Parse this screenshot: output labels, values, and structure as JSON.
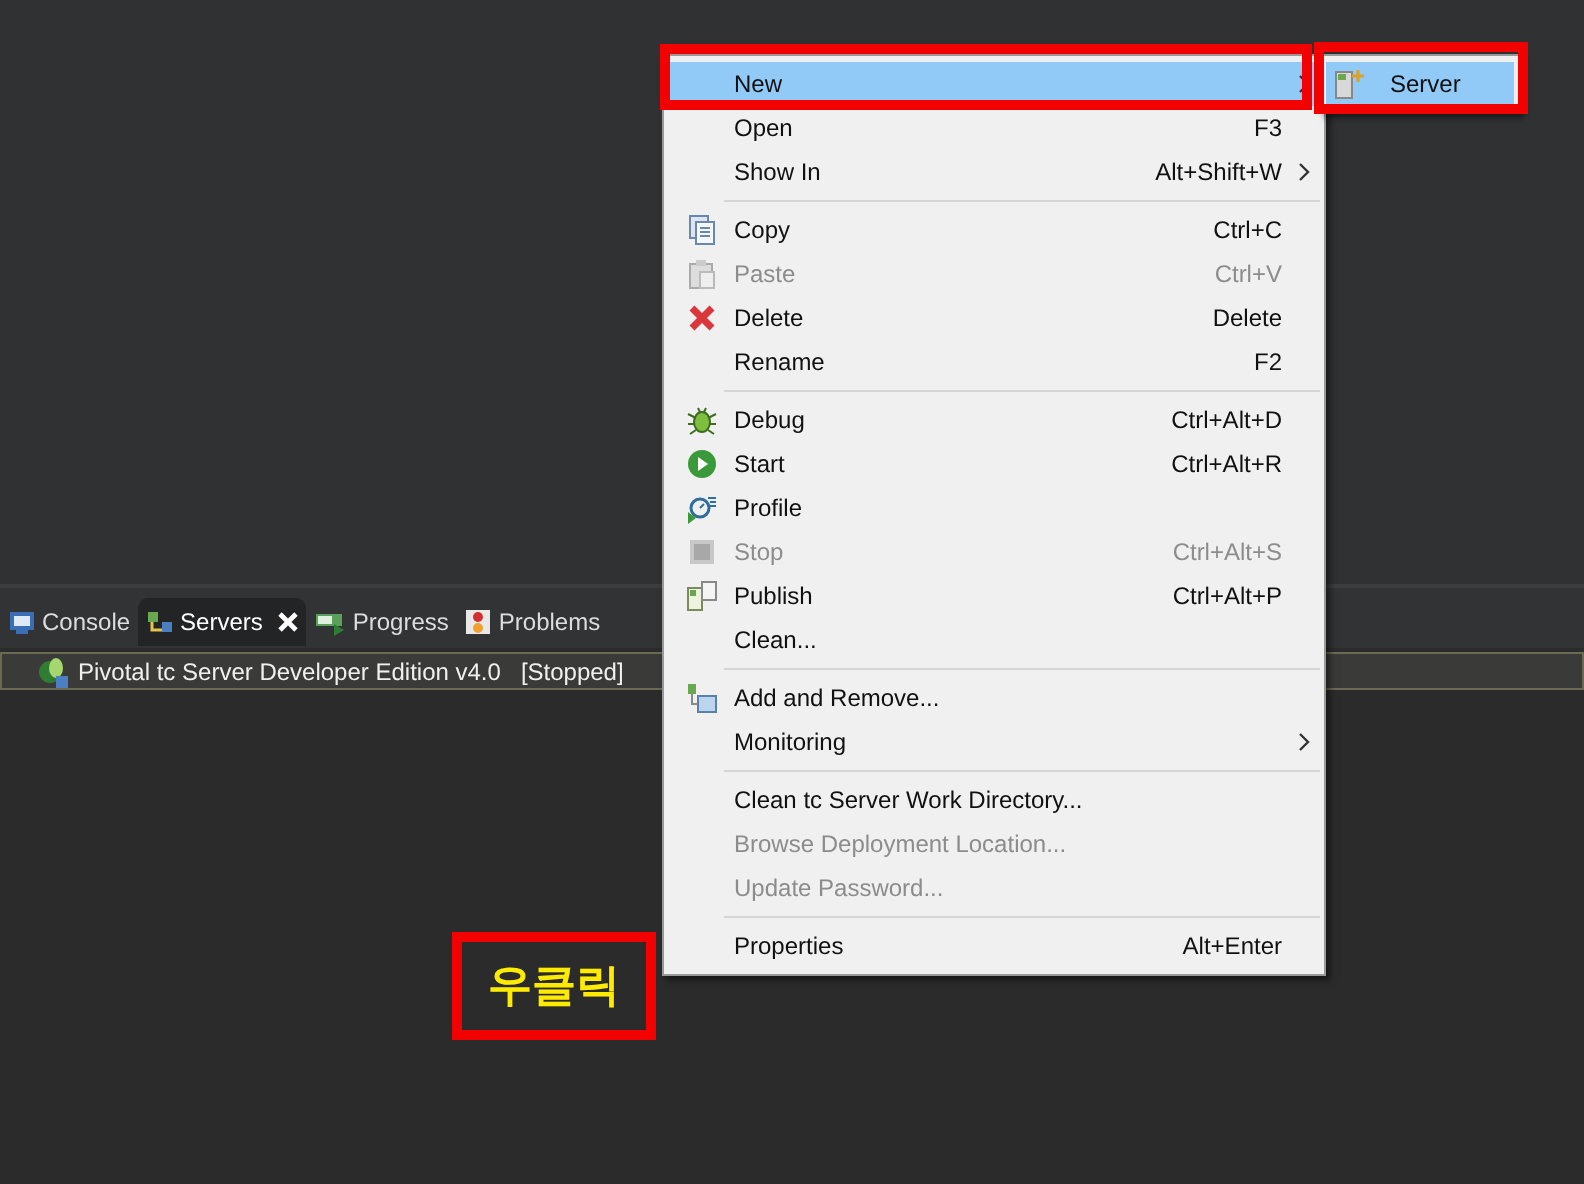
{
  "panel": {
    "tabs": [
      {
        "label": "Console",
        "selected": false,
        "closable": false
      },
      {
        "label": "Servers",
        "selected": true,
        "closable": true
      },
      {
        "label": "Progress",
        "selected": false,
        "closable": false
      },
      {
        "label": "Problems",
        "selected": false,
        "closable": false
      }
    ],
    "servers": [
      {
        "name": "Pivotal tc Server Developer Edition v4.0",
        "status": "[Stopped]"
      }
    ]
  },
  "context_menu": {
    "items": [
      {
        "kind": "item",
        "label": "New",
        "submenu": true,
        "disabled": false,
        "selected": true
      },
      {
        "kind": "item",
        "label": "Open",
        "shortcut": "F3",
        "submenu": false,
        "disabled": false,
        "selected": false
      },
      {
        "kind": "item",
        "label": "Show In",
        "shortcut": "Alt+Shift+W",
        "submenu": true,
        "disabled": false,
        "selected": false
      },
      {
        "kind": "separator"
      },
      {
        "kind": "item",
        "label": "Copy",
        "shortcut": "Ctrl+C",
        "submenu": false,
        "disabled": false,
        "selected": false
      },
      {
        "kind": "item",
        "label": "Paste",
        "shortcut": "Ctrl+V",
        "submenu": false,
        "disabled": true,
        "selected": false
      },
      {
        "kind": "item",
        "label": "Delete",
        "shortcut": "Delete",
        "submenu": false,
        "disabled": false,
        "selected": false
      },
      {
        "kind": "item",
        "label": "Rename",
        "shortcut": "F2",
        "submenu": false,
        "disabled": false,
        "selected": false
      },
      {
        "kind": "separator"
      },
      {
        "kind": "item",
        "label": "Debug",
        "shortcut": "Ctrl+Alt+D",
        "submenu": false,
        "disabled": false,
        "selected": false
      },
      {
        "kind": "item",
        "label": "Start",
        "shortcut": "Ctrl+Alt+R",
        "submenu": false,
        "disabled": false,
        "selected": false
      },
      {
        "kind": "item",
        "label": "Profile",
        "submenu": false,
        "disabled": false,
        "selected": false
      },
      {
        "kind": "item",
        "label": "Stop",
        "shortcut": "Ctrl+Alt+S",
        "submenu": false,
        "disabled": true,
        "selected": false
      },
      {
        "kind": "item",
        "label": "Publish",
        "shortcut": "Ctrl+Alt+P",
        "submenu": false,
        "disabled": false,
        "selected": false
      },
      {
        "kind": "item",
        "label": "Clean...",
        "submenu": false,
        "disabled": false,
        "selected": false
      },
      {
        "kind": "separator"
      },
      {
        "kind": "item",
        "label": "Add and Remove...",
        "submenu": false,
        "disabled": false,
        "selected": false
      },
      {
        "kind": "item",
        "label": "Monitoring",
        "submenu": true,
        "disabled": false,
        "selected": false
      },
      {
        "kind": "separator"
      },
      {
        "kind": "item",
        "label": "Clean tc Server Work Directory...",
        "submenu": false,
        "disabled": false,
        "selected": false
      },
      {
        "kind": "item",
        "label": "Browse Deployment Location...",
        "submenu": false,
        "disabled": true,
        "selected": false
      },
      {
        "kind": "item",
        "label": "Update Password...",
        "submenu": false,
        "disabled": true,
        "selected": false
      },
      {
        "kind": "separator"
      },
      {
        "kind": "item",
        "label": "Properties",
        "shortcut": "Alt+Enter",
        "submenu": false,
        "disabled": false,
        "selected": false
      }
    ]
  },
  "submenu": {
    "items": [
      {
        "label": "Server",
        "selected": true
      }
    ]
  },
  "annotation": {
    "text": "우클릭"
  }
}
